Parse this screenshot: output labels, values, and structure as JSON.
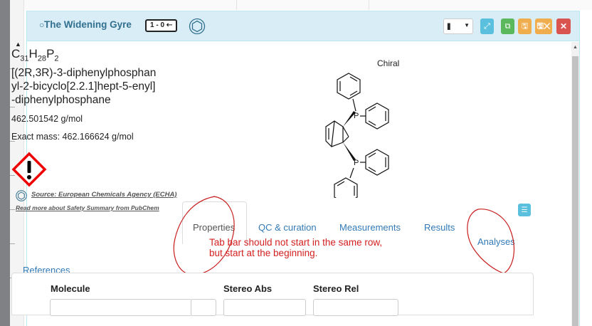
{
  "panel": {
    "title": "The Widening Gyre",
    "count_badge": "1 - 0 ⇠",
    "header_color": "#d9edf7",
    "title_color": "#31708f",
    "title_icon": "circle-outline-icon",
    "chem_icon": "hexagon-icon"
  },
  "header_buttons": {
    "barcode": {
      "icon": "barcode-icon",
      "label": "||||||"
    },
    "expand": {
      "icon": "expand-icon",
      "label": "⤢",
      "color": "#5bc0de"
    },
    "copy": {
      "icon": "copy-icon",
      "label": "⧉",
      "color": "#5cb85c"
    },
    "save": {
      "icon": "save-icon",
      "label": "🖫",
      "color": "#f0ad4e"
    },
    "save_close": {
      "icon": "save-close-icon",
      "label": "🖫✕",
      "color": "#f0ad4e"
    },
    "close": {
      "icon": "close-icon",
      "label": "✕",
      "color": "#d9534f"
    }
  },
  "molecule": {
    "formula": {
      "C": "31",
      "H": "28",
      "P": "2"
    },
    "iupac": "[(2R,3R)-3-diphenylphosphanyl-2-bicyclo[2.2.1]hept-5-enyl]-diphenylphosphane",
    "iupac_lines": [
      "[(2R,3R)-3-diphenylphosphan",
      "yl-2-bicyclo[2.2.1]hept-5-enyl]",
      "-diphenylphosphane"
    ],
    "molecular_weight": "462.501542 g/mol",
    "exact_mass": "Exact mass: 462.166624 g/mol",
    "stereo_label": "Chiral",
    "hazard_icon": "ghs-exclamation-icon",
    "source_text": "Source: European Chemicals Agency (ECHA)",
    "more_link": "Read more about Safety Summary from PubChem"
  },
  "tabs": [
    {
      "label": "Properties",
      "active": true
    },
    {
      "label": "QC & curation",
      "active": false
    },
    {
      "label": "Measurements",
      "active": false
    },
    {
      "label": "Results",
      "active": false
    },
    {
      "label": "Analyses",
      "active": false
    },
    {
      "label": "References",
      "active": false
    }
  ],
  "annotation": {
    "text_lines": [
      "Tab bar should not start in the same row,",
      "but start at the beginning."
    ],
    "color": "#d42020"
  },
  "form": {
    "molecule_label": "Molecule",
    "stereo_abs_label": "Stereo Abs",
    "stereo_rel_label": "Stereo Rel"
  }
}
